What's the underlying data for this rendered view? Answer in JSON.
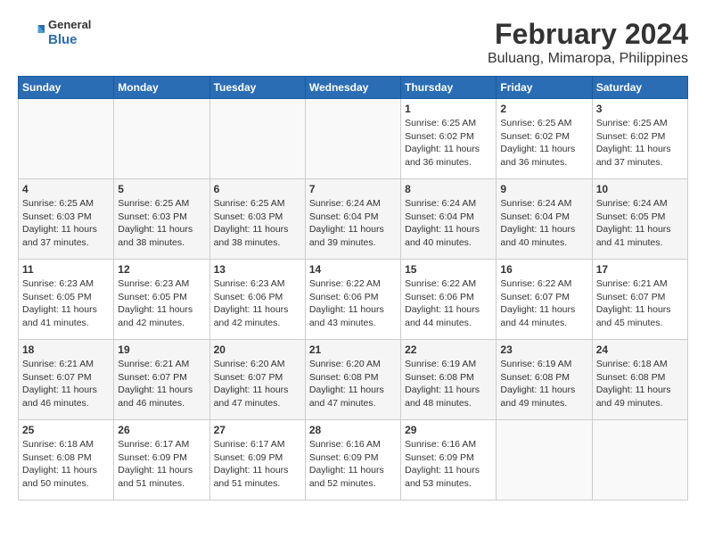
{
  "header": {
    "logo_general": "General",
    "logo_blue": "Blue",
    "title": "February 2024",
    "subtitle": "Buluang, Mimaropa, Philippines"
  },
  "calendar": {
    "weekdays": [
      "Sunday",
      "Monday",
      "Tuesday",
      "Wednesday",
      "Thursday",
      "Friday",
      "Saturday"
    ],
    "weeks": [
      [
        {
          "day": "",
          "info": ""
        },
        {
          "day": "",
          "info": ""
        },
        {
          "day": "",
          "info": ""
        },
        {
          "day": "",
          "info": ""
        },
        {
          "day": "1",
          "info": "Sunrise: 6:25 AM\nSunset: 6:02 PM\nDaylight: 11 hours\nand 36 minutes."
        },
        {
          "day": "2",
          "info": "Sunrise: 6:25 AM\nSunset: 6:02 PM\nDaylight: 11 hours\nand 36 minutes."
        },
        {
          "day": "3",
          "info": "Sunrise: 6:25 AM\nSunset: 6:02 PM\nDaylight: 11 hours\nand 37 minutes."
        }
      ],
      [
        {
          "day": "4",
          "info": "Sunrise: 6:25 AM\nSunset: 6:03 PM\nDaylight: 11 hours\nand 37 minutes."
        },
        {
          "day": "5",
          "info": "Sunrise: 6:25 AM\nSunset: 6:03 PM\nDaylight: 11 hours\nand 38 minutes."
        },
        {
          "day": "6",
          "info": "Sunrise: 6:25 AM\nSunset: 6:03 PM\nDaylight: 11 hours\nand 38 minutes."
        },
        {
          "day": "7",
          "info": "Sunrise: 6:24 AM\nSunset: 6:04 PM\nDaylight: 11 hours\nand 39 minutes."
        },
        {
          "day": "8",
          "info": "Sunrise: 6:24 AM\nSunset: 6:04 PM\nDaylight: 11 hours\nand 40 minutes."
        },
        {
          "day": "9",
          "info": "Sunrise: 6:24 AM\nSunset: 6:04 PM\nDaylight: 11 hours\nand 40 minutes."
        },
        {
          "day": "10",
          "info": "Sunrise: 6:24 AM\nSunset: 6:05 PM\nDaylight: 11 hours\nand 41 minutes."
        }
      ],
      [
        {
          "day": "11",
          "info": "Sunrise: 6:23 AM\nSunset: 6:05 PM\nDaylight: 11 hours\nand 41 minutes."
        },
        {
          "day": "12",
          "info": "Sunrise: 6:23 AM\nSunset: 6:05 PM\nDaylight: 11 hours\nand 42 minutes."
        },
        {
          "day": "13",
          "info": "Sunrise: 6:23 AM\nSunset: 6:06 PM\nDaylight: 11 hours\nand 42 minutes."
        },
        {
          "day": "14",
          "info": "Sunrise: 6:22 AM\nSunset: 6:06 PM\nDaylight: 11 hours\nand 43 minutes."
        },
        {
          "day": "15",
          "info": "Sunrise: 6:22 AM\nSunset: 6:06 PM\nDaylight: 11 hours\nand 44 minutes."
        },
        {
          "day": "16",
          "info": "Sunrise: 6:22 AM\nSunset: 6:07 PM\nDaylight: 11 hours\nand 44 minutes."
        },
        {
          "day": "17",
          "info": "Sunrise: 6:21 AM\nSunset: 6:07 PM\nDaylight: 11 hours\nand 45 minutes."
        }
      ],
      [
        {
          "day": "18",
          "info": "Sunrise: 6:21 AM\nSunset: 6:07 PM\nDaylight: 11 hours\nand 46 minutes."
        },
        {
          "day": "19",
          "info": "Sunrise: 6:21 AM\nSunset: 6:07 PM\nDaylight: 11 hours\nand 46 minutes."
        },
        {
          "day": "20",
          "info": "Sunrise: 6:20 AM\nSunset: 6:07 PM\nDaylight: 11 hours\nand 47 minutes."
        },
        {
          "day": "21",
          "info": "Sunrise: 6:20 AM\nSunset: 6:08 PM\nDaylight: 11 hours\nand 47 minutes."
        },
        {
          "day": "22",
          "info": "Sunrise: 6:19 AM\nSunset: 6:08 PM\nDaylight: 11 hours\nand 48 minutes."
        },
        {
          "day": "23",
          "info": "Sunrise: 6:19 AM\nSunset: 6:08 PM\nDaylight: 11 hours\nand 49 minutes."
        },
        {
          "day": "24",
          "info": "Sunrise: 6:18 AM\nSunset: 6:08 PM\nDaylight: 11 hours\nand 49 minutes."
        }
      ],
      [
        {
          "day": "25",
          "info": "Sunrise: 6:18 AM\nSunset: 6:08 PM\nDaylight: 11 hours\nand 50 minutes."
        },
        {
          "day": "26",
          "info": "Sunrise: 6:17 AM\nSunset: 6:09 PM\nDaylight: 11 hours\nand 51 minutes."
        },
        {
          "day": "27",
          "info": "Sunrise: 6:17 AM\nSunset: 6:09 PM\nDaylight: 11 hours\nand 51 minutes."
        },
        {
          "day": "28",
          "info": "Sunrise: 6:16 AM\nSunset: 6:09 PM\nDaylight: 11 hours\nand 52 minutes."
        },
        {
          "day": "29",
          "info": "Sunrise: 6:16 AM\nSunset: 6:09 PM\nDaylight: 11 hours\nand 53 minutes."
        },
        {
          "day": "",
          "info": ""
        },
        {
          "day": "",
          "info": ""
        }
      ]
    ]
  }
}
